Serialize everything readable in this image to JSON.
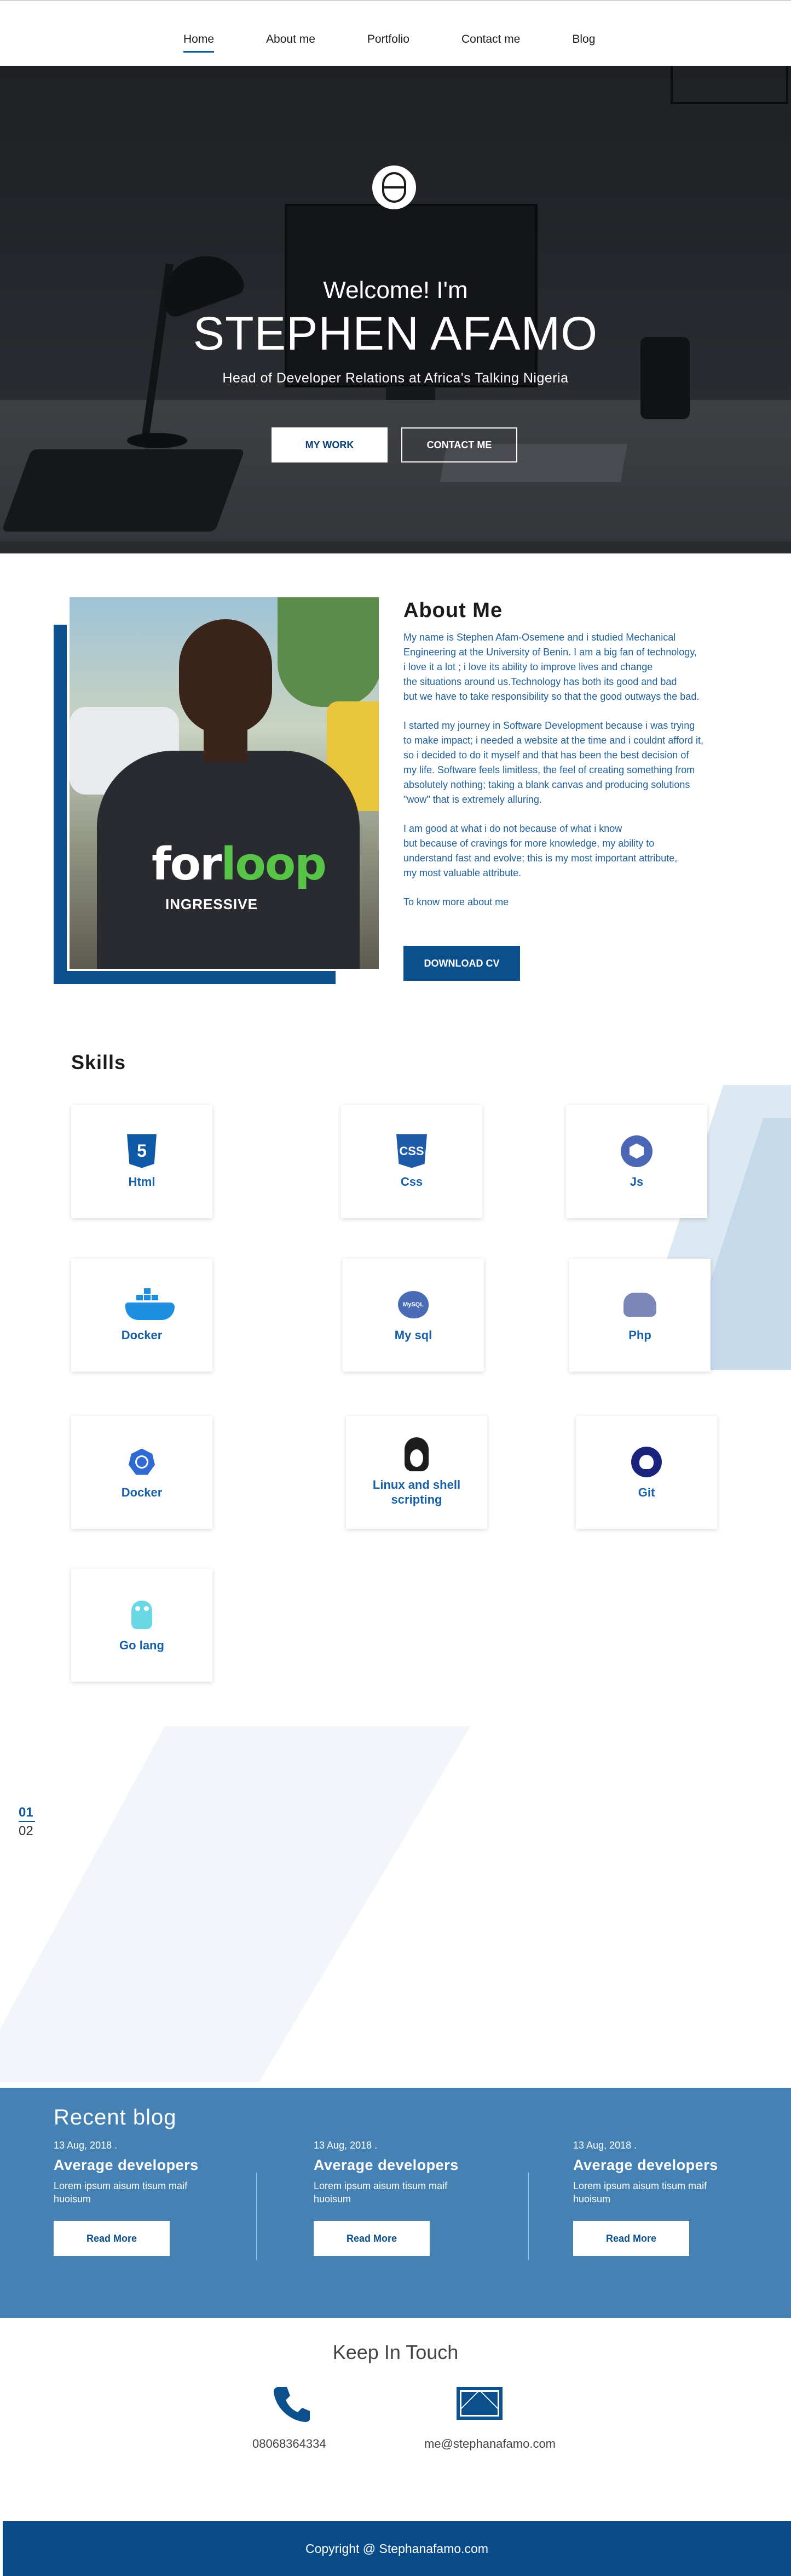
{
  "nav": {
    "items": [
      {
        "label": "Home"
      },
      {
        "label": "About me"
      },
      {
        "label": "Portfolio"
      },
      {
        "label": "Contact me"
      },
      {
        "label": "Blog"
      }
    ]
  },
  "hero": {
    "welcome": "Welcome! I'm",
    "name": "STEPHEN AFAMO",
    "tagline": "Head of Developer Relations at Africa's Talking Nigeria",
    "btn_work": "MY WORK",
    "btn_contact": "CONTACT ME",
    "photo_text_for": "for",
    "photo_text_loop": "loop",
    "photo_text_ingressive": "INGRESSIVE"
  },
  "about": {
    "title": "About Me",
    "p1": "My name is Stephen Afam-Osemene and  i studied Mechanical\nEngineering at the University of Benin. I am a big fan of technology,\ni love it a lot ; i love its ability to improve lives and change\nthe situations around us.Technology has both its good and bad\nbut  we have to take responsibility so that the good  outways the bad.",
    "p2": "I started my journey in Software Development because i was trying\nto make impact; i needed a website at the time and i couldnt afford it,\nso i decided to do it myself and that has been the best decision  of\nmy life. Software feels limitless, the feel of creating something from\nabsolutely nothing; taking a blank canvas and producing solutions\n\"wow\" that is extremely alluring.",
    "p3": "I am good at what i do not because of what i know\nbut because of cravings for more knowledge, my ability to\nunderstand fast and evolve; this is my most important attribute,\n my most valuable attribute.",
    "p4": "To know more about me",
    "btn_cv": "DOWNLOAD CV"
  },
  "skills": {
    "title": "Skills",
    "items": [
      {
        "label": "Html",
        "icon": "html5-icon",
        "badge": "5"
      },
      {
        "label": "Css",
        "icon": "css3-icon",
        "badge": "CSS"
      },
      {
        "label": "Js",
        "icon": "js-icon"
      },
      {
        "label": "Docker",
        "icon": "docker-icon"
      },
      {
        "label": "My sql",
        "icon": "mysql-icon",
        "badge": "MySQL"
      },
      {
        "label": "Php",
        "icon": "php-elephant-icon"
      },
      {
        "label": "Docker",
        "icon": "kubernetes-icon"
      },
      {
        "label": "Linux and shell scripting",
        "icon": "linux-tux-icon"
      },
      {
        "label": "Git",
        "icon": "github-icon"
      },
      {
        "label": "Go lang",
        "icon": "gopher-icon"
      }
    ]
  },
  "pagination": {
    "page1": "01",
    "page2": "02"
  },
  "blog": {
    "title": "Recent blog",
    "posts": [
      {
        "date": "13 Aug, 2018 .",
        "heading": "Average developers",
        "excerpt": "Lorem ipsum aisum tisum maif huoisum",
        "btn": "Read More"
      },
      {
        "date": "13 Aug, 2018 .",
        "heading": "Average developers",
        "excerpt": "Lorem ipsum aisum tisum maif huoisum",
        "btn": "Read More"
      },
      {
        "date": "13 Aug, 2018 .",
        "heading": "Average developers",
        "excerpt": "Lorem ipsum aisum tisum maif huoisum",
        "btn": "Read More"
      }
    ]
  },
  "contact": {
    "title": "Keep In Touch",
    "phone": "08068364334",
    "email": "me@stephanafamo.com"
  },
  "footer": {
    "copyright": "Copyright @ Stephanafamo.com"
  },
  "colors": {
    "brand": "#0b4f8c",
    "blog_bg": "#4581b3",
    "link_text": "#1e5f9c"
  }
}
